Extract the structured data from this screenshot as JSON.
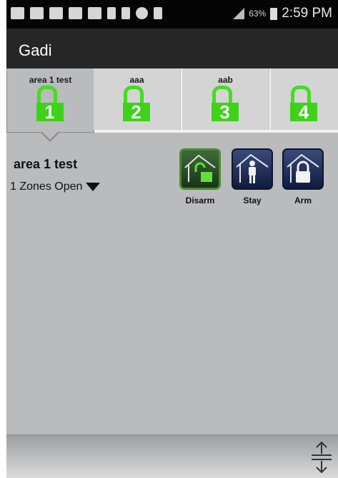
{
  "status_bar": {
    "icons": [
      "add-icon",
      "gallery-icon",
      "gallery-icon",
      "search-icon",
      "gallery-icon",
      "person-icon",
      "bluetooth-icon",
      "alarm-icon",
      "wifi-icon",
      "signal-icon"
    ],
    "battery": "63%",
    "time": "2:59 PM"
  },
  "app_bar": {
    "title": "Gadi"
  },
  "areas": [
    {
      "label": "area 1 test",
      "number": "1"
    },
    {
      "label": "aaa",
      "number": "2"
    },
    {
      "label": "aab",
      "number": "3"
    },
    {
      "label": "",
      "number": "4"
    }
  ],
  "detail": {
    "title": "area 1 test",
    "zones_status": "1 Zones Open"
  },
  "modes": [
    {
      "label": "Disarm",
      "icon": "disarm-icon"
    },
    {
      "label": "Stay",
      "icon": "stay-icon"
    },
    {
      "label": "Arm",
      "icon": "arm-icon"
    }
  ],
  "colors": {
    "lock_green": "#3ed219",
    "mode_navy": "#101b3f",
    "mode_selected_green": "#4c8a2f",
    "content_gray": "#b9bbbd"
  }
}
